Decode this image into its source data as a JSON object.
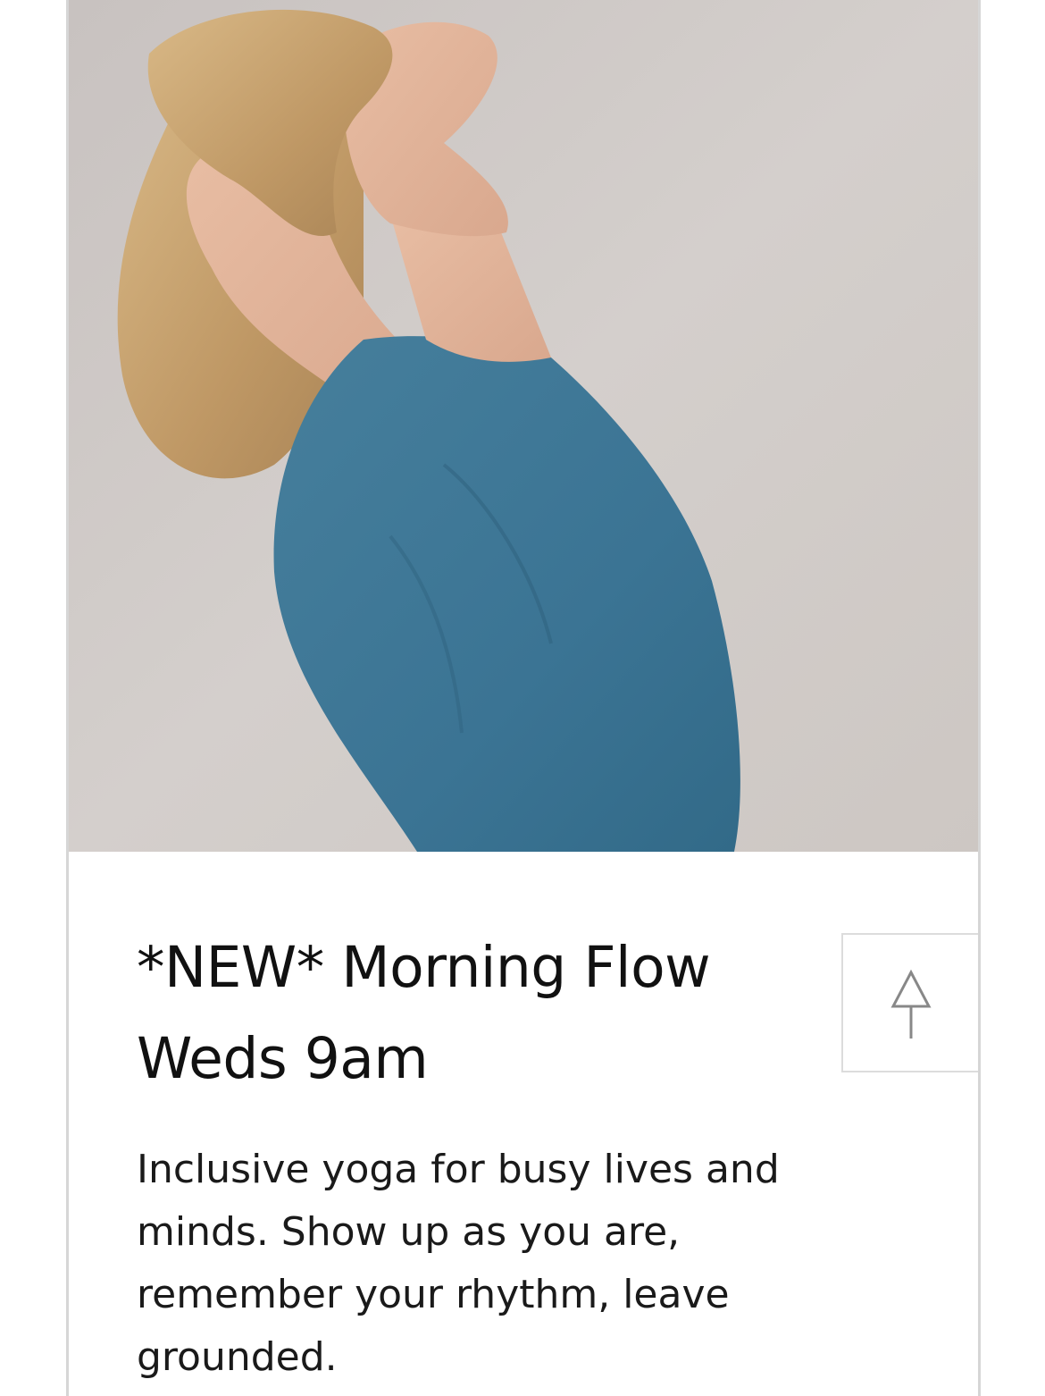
{
  "class_card": {
    "title_line_1": "*NEW* Morning Flow",
    "title_line_2": "Weds 9am",
    "description": "Inclusive yoga for busy lives and minds. Show up as you are, remember your rhythm, leave grounded.",
    "image_icon": "yoga-instructor-photo"
  },
  "scroll_to_top": {
    "icon": "arrow-up-icon"
  },
  "colors": {
    "background": "#ffffff",
    "card_border": "#d6d6d6",
    "title_text": "#111111",
    "body_text": "#1a1a1a",
    "photo_wall": "#cfc9c6",
    "shirt": "#3e7d9c",
    "hair": "#c9a46f",
    "skin": "#e3b59b"
  }
}
